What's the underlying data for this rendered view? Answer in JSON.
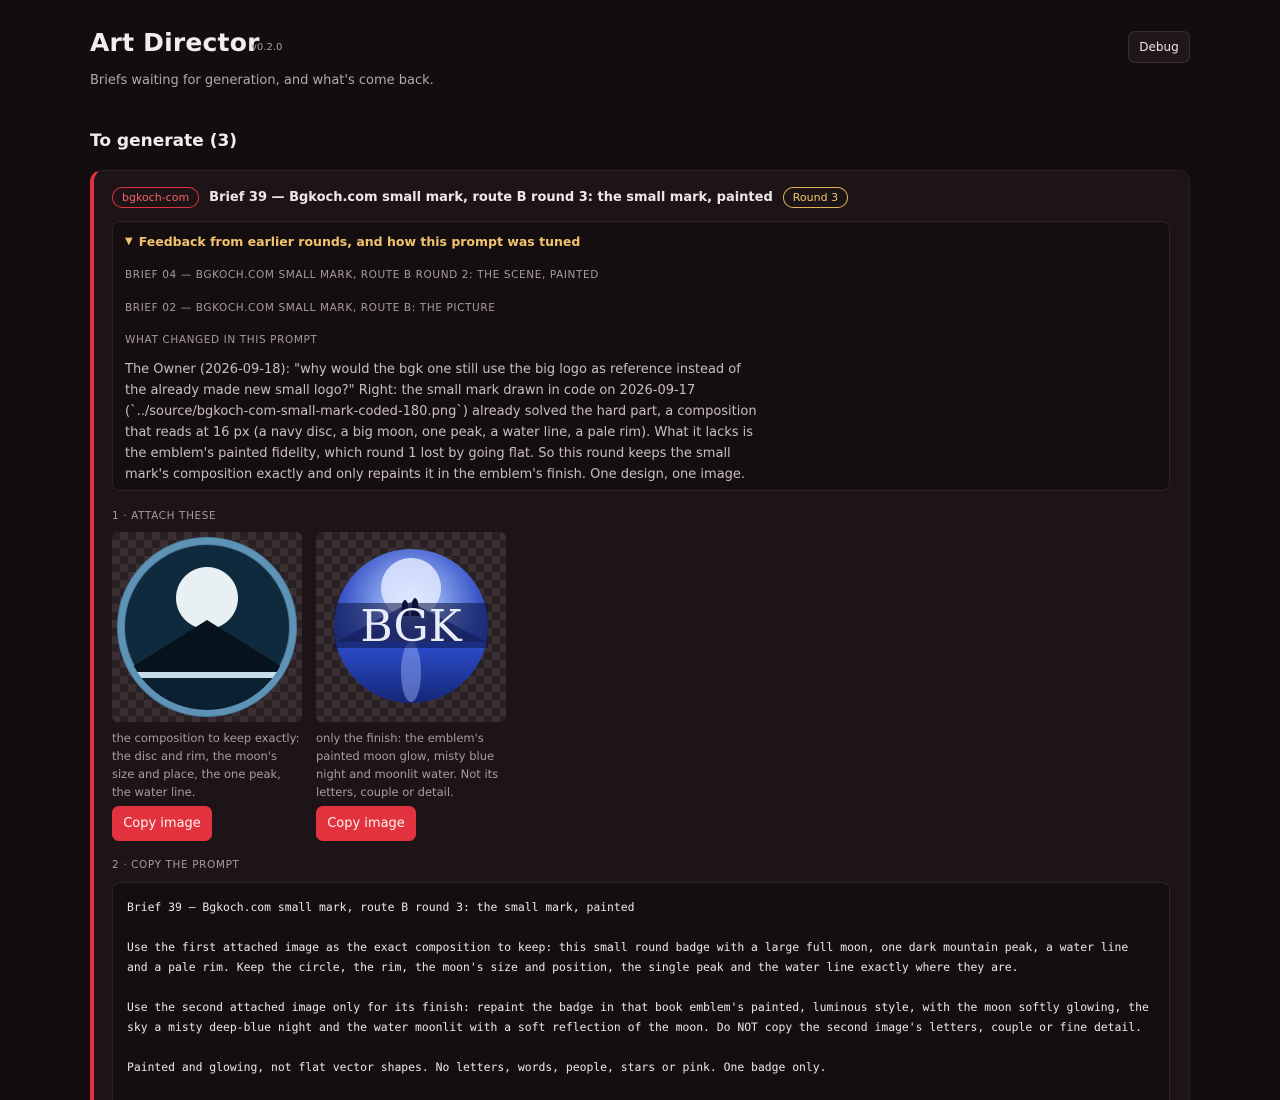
{
  "app": {
    "title": "Art Director",
    "version": "v0.2.0",
    "subtitle": "Briefs waiting for generation, and what's come back.",
    "debug_label": "Debug"
  },
  "section": {
    "title": "To generate (3)"
  },
  "brief": {
    "tag": "bgkoch-com",
    "title": "Brief 39 — Bgkoch.com small mark, route B round 3: the small mark, painted",
    "round": "Round 3",
    "feedback": {
      "summary": "Feedback from earlier rounds, and how this prompt was tuned",
      "items": [
        "Brief 04 — Bgkoch.com small mark, route B round 2: the scene, painted",
        "Brief 02 — Bgkoch.com small mark, route B: the picture"
      ],
      "changed_label": "What changed in this prompt",
      "changed_text": "The Owner (2026-09-18): \"why would the bgk one still use the big logo as reference instead of the already made new small logo?\" Right: the small mark drawn in code on 2026-09-17 (`../source/bgkoch-com-small-mark-coded-180.png`) already solved the hard part, a composition that reads at 16 px (a navy disc, a big moon, one peak, a water line, a pale rim). What it lacks is the emblem's painted fidelity, which round 1 lost by going flat. So this round keeps the small mark's composition exactly and only repaints it in the emblem's finish. One design, one image."
    },
    "attach": {
      "label": "1 · Attach these",
      "images": [
        {
          "icon": "moon-peak-badge",
          "caption": "the composition to keep exactly: the disc and rim, the moon's size and place, the one peak, the water line.",
          "button": "Copy image"
        },
        {
          "icon": "bgk-emblem",
          "emblem_text": "BGK",
          "caption": "only the finish: the emblem's painted moon glow, misty blue night and moonlit water. Not its letters, couple or detail.",
          "button": "Copy image"
        }
      ]
    },
    "prompt": {
      "label": "2 · Copy the prompt",
      "paragraphs": [
        "Brief 39 — Bgkoch.com small mark, route B round 3: the small mark, painted",
        "Use the first attached image as the exact composition to keep: this small round badge with a large full moon, one dark mountain peak, a water line and a pale rim. Keep the circle, the rim, the moon's size and position, the single peak and the water line exactly where they are.",
        "Use the second attached image only for its finish: repaint the badge in that book emblem's painted, luminous style, with the moon softly glowing, the sky a misty deep-blue night and the water moonlit with a soft reflection of the moon. Do NOT copy the second image's letters, couple or fine detail.",
        "Painted and glowing, not flat vector shapes. No letters, words, people, stars or pink. One badge only."
      ]
    }
  },
  "colors": {
    "background": "#130d0f",
    "accent": "#e0313d",
    "round_badge": "#e5b25a"
  }
}
